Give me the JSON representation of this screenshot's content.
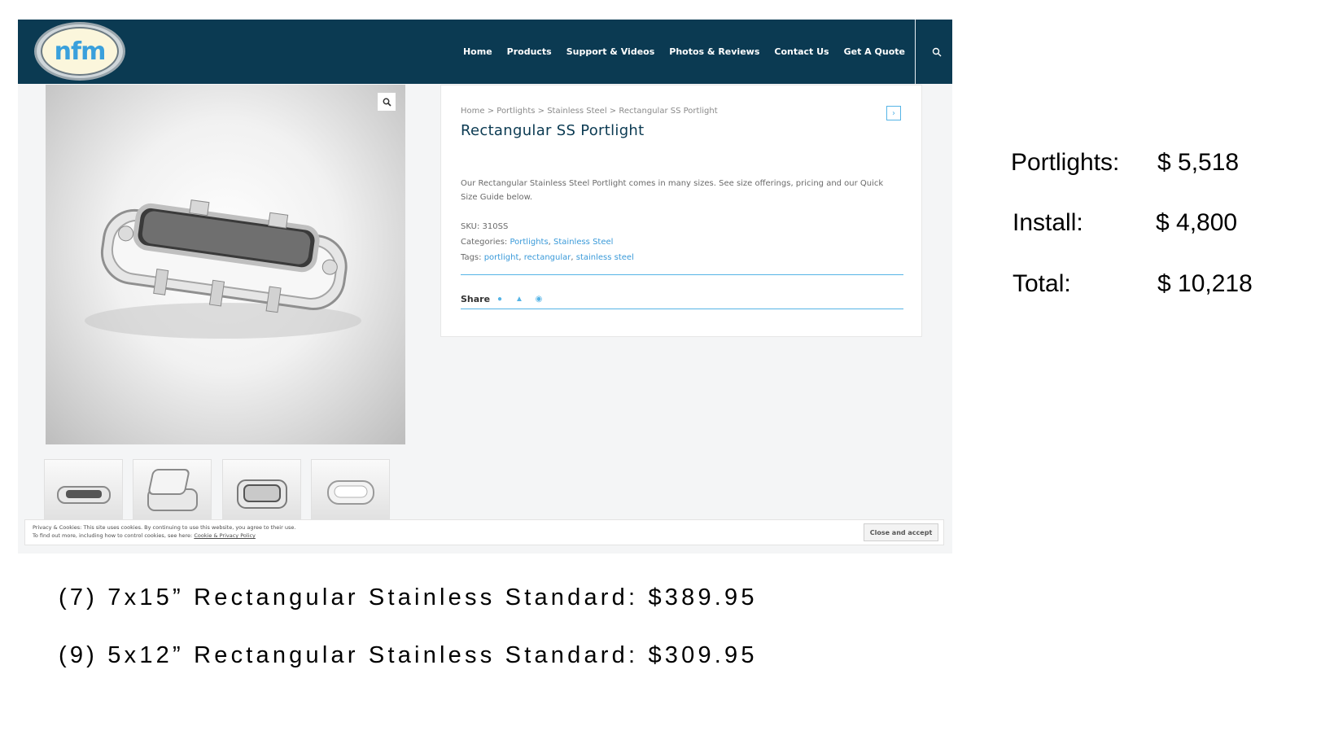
{
  "site": {
    "logo_text": "nfm",
    "nav": [
      "Home",
      "Products",
      "Support & Videos",
      "Photos & Reviews",
      "Contact Us",
      "Get A Quote"
    ],
    "breadcrumb": "Home > Portlights > Stainless Steel > Rectangular SS Portlight",
    "product_title": "Rectangular SS Portlight",
    "description": "Our Rectangular Stainless Steel Portlight comes in many sizes. See size offerings, pricing and our Quick Size Guide below.",
    "sku_label": "SKU:",
    "sku": "310SS",
    "categories_label": "Categories:",
    "categories": [
      "Portlights",
      "Stainless Steel"
    ],
    "tags_label": "Tags:",
    "tags": [
      "portlight",
      "rectangular",
      "stainless steel"
    ],
    "share_label": "Share",
    "cookie_line1": "Privacy & Cookies: This site uses cookies. By continuing to use this website, you agree to their use.",
    "cookie_line2": "To find out more, including how to control cookies, see here:",
    "cookie_link": "Cookie & Privacy Policy",
    "cookie_button": "Close and accept",
    "colors": {
      "header": "#0b3a52",
      "link": "#3a9ad9",
      "accent": "#56b4e6"
    }
  },
  "summary": {
    "portlights_label": "Portlights:",
    "portlights_value": "$ 5,518",
    "install_label": "Install:",
    "install_value": "$ 4,800",
    "total_label": "Total:",
    "total_value": "$ 10,218"
  },
  "items": [
    "(7) 7x15” Rectangular Stainless Standard: $389.95",
    "(9) 5x12” Rectangular Stainless Standard: $309.95"
  ]
}
